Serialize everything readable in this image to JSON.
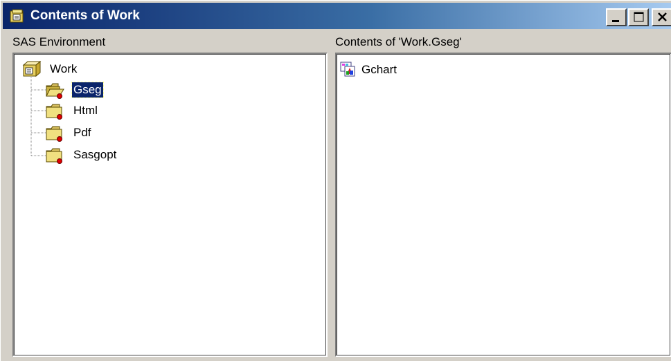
{
  "window": {
    "title": "Contents of Work",
    "controls": {
      "minimize": "minimize-icon",
      "maximize": "maximize-icon",
      "close": "close-icon"
    },
    "titlebar_colors": [
      "#0a246a",
      "#a6caf0"
    ]
  },
  "left_pane": {
    "label": "SAS Environment",
    "tree": {
      "root": {
        "label": "Work",
        "icon": "library-drawer-icon"
      },
      "children": [
        {
          "label": "Gseg",
          "icon": "open-folder-icon",
          "selected": true
        },
        {
          "label": "Html",
          "icon": "folder-icon",
          "selected": false
        },
        {
          "label": "Pdf",
          "icon": "folder-icon",
          "selected": false
        },
        {
          "label": "Sasgopt",
          "icon": "folder-icon",
          "selected": false
        }
      ]
    }
  },
  "right_pane": {
    "label": "Contents of 'Work.Gseg'",
    "items": [
      {
        "label": "Gchart",
        "icon": "graph-entry-icon"
      }
    ]
  },
  "colors": {
    "selection_bg": "#0a246a",
    "selection_fg": "#ffffff",
    "dialog_face": "#d4d0c8"
  }
}
